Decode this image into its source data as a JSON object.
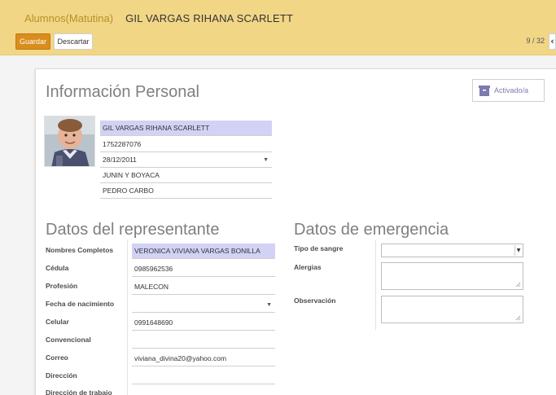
{
  "header": {
    "breadcrumb_parent": "Alumnos(Matutina)",
    "breadcrumb_current": "GIL VARGAS RIHANA SCARLETT",
    "save_label": "Guardar",
    "discard_label": "Descartar",
    "pager": "9 / 32",
    "pager_prev_icon": "‹"
  },
  "status_button": {
    "label": "Activado/a",
    "icon": "archive-icon"
  },
  "personal": {
    "title": "Información Personal",
    "full_name": "GIL  VARGAS RIHANA SCARLETT",
    "id_number": "1752287076",
    "birth_date": "28/12/2011",
    "address": "JUNIN Y BOYACA",
    "city": "PEDRO CARBO"
  },
  "representative": {
    "title": "Datos del representante",
    "fields": [
      {
        "label": "Nombres Completos",
        "value": "VERONICA VIVIANA VARGAS BONILLA"
      },
      {
        "label": "Cédula",
        "value": "0985962536"
      },
      {
        "label": "Profesión",
        "value": "MALECON"
      },
      {
        "label": "Fecha de nacimiento",
        "value": ""
      },
      {
        "label": "Celular",
        "value": "0991648690"
      },
      {
        "label": "Convencional",
        "value": ""
      },
      {
        "label": "Correo",
        "value": "viviana_divina20@yahoo.com"
      },
      {
        "label": "Dirección",
        "value": ""
      },
      {
        "label": "Dirección de trabajo",
        "value": ""
      }
    ]
  },
  "emergency": {
    "title": "Datos de emergencia",
    "blood_type_label": "Tipo de sangre",
    "blood_type_value": "",
    "allergies_label": "Alergias",
    "allergies_value": "",
    "observation_label": "Observación",
    "observation_value": ""
  },
  "colors": {
    "header_bg": "#f1d686",
    "primary_button": "#d98d1c",
    "required_field": "#d2d2f5",
    "accent_link": "#b89028"
  }
}
